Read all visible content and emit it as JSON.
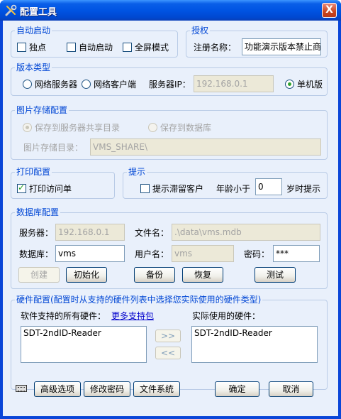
{
  "window": {
    "title": "配置工具",
    "close": "X"
  },
  "autostart": {
    "group_title": "自动启动",
    "standalone_label": "独点",
    "autostart_label": "自动启动",
    "fullscreen_label": "全屏模式"
  },
  "license": {
    "group_title": "授权",
    "reg_name_label": "注册名称：",
    "reg_name_value": "功能演示版本禁止商"
  },
  "version": {
    "group_title": "版本类型",
    "network_server": "网络服务器",
    "network_client": "网络客户端",
    "server_ip_label": "服务器IP：",
    "server_ip_value": "192.168.0.1",
    "standalone": "单机版"
  },
  "image_storage": {
    "group_title": "图片存储配置",
    "save_share": "保存到服务器共享目录",
    "save_db": "保存到数据库",
    "dir_label": "图片存储目录：",
    "dir_value": "VMS_SHARE\\"
  },
  "print": {
    "group_title": "打印配置",
    "print_visit_label": "打印访问单"
  },
  "hint": {
    "group_title": "提示",
    "detain_label": "提示滞留客户",
    "age_less_label": "年龄小于",
    "age_value": "0",
    "age_suffix": "岁时提示"
  },
  "database": {
    "group_title": "数据库配置",
    "server_label": "服务器：",
    "server_value": "192.168.0.1",
    "file_label": "文件名：",
    "file_value": ".\\data\\vms.mdb",
    "db_label": "数据库：",
    "db_value": "vms",
    "user_label": "用户名：",
    "user_value": "vms",
    "pwd_label": "密码：",
    "pwd_value": "***",
    "create_btn": "创建",
    "init_btn": "初始化",
    "backup_btn": "备份",
    "restore_btn": "恢复",
    "test_btn": "测试"
  },
  "hardware": {
    "group_title": "硬件配置(配置时从支持的硬件列表中选择您实际使用的硬件类型)",
    "supported_label": "软件支持的所有硬件：",
    "more_link": "更多支持包",
    "actual_label": "实际使用的硬件：",
    "supported_items": [
      "SDT-2ndID-Reader"
    ],
    "actual_items": [
      "SDT-2ndID-Reader"
    ],
    "add_btn": ">>",
    "remove_btn": "<<"
  },
  "footer": {
    "advanced_btn": "高级选项",
    "change_pwd_btn": "修改密码",
    "filesystem_btn": "文件系统",
    "ok_btn": "确定",
    "cancel_btn": "取消"
  }
}
